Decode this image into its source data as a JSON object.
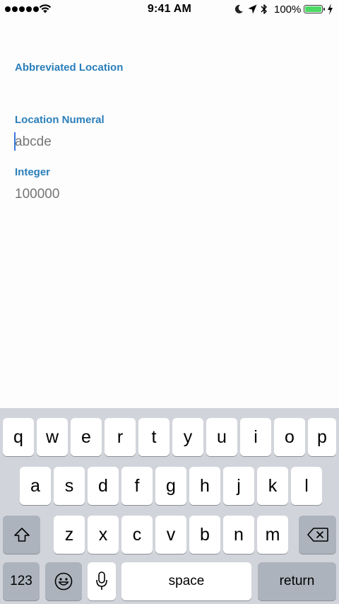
{
  "status_bar": {
    "time": "9:41 AM",
    "battery_percent": "100%",
    "signal_bars": 5,
    "battery_color": "#4cd964"
  },
  "form": {
    "fields": [
      {
        "label": "Abbreviated Location",
        "value": "",
        "placeholder": ""
      },
      {
        "label": "Location Numeral",
        "value": "",
        "placeholder": "abcde"
      },
      {
        "label": "Integer",
        "value": "",
        "placeholder": "100000"
      }
    ],
    "label_color": "#2a7fba",
    "placeholder_color": "#c6c6cb"
  },
  "keyboard": {
    "row1": [
      "q",
      "w",
      "e",
      "r",
      "t",
      "y",
      "u",
      "i",
      "o",
      "p"
    ],
    "row2": [
      "a",
      "s",
      "d",
      "f",
      "g",
      "h",
      "j",
      "k",
      "l"
    ],
    "row3": [
      "z",
      "x",
      "c",
      "v",
      "b",
      "n",
      "m"
    ],
    "numbers_key": "123",
    "space_key": "space",
    "return_key": "return",
    "icons": [
      "shift-icon",
      "backspace-icon",
      "emoji-icon",
      "microphone-icon"
    ]
  }
}
